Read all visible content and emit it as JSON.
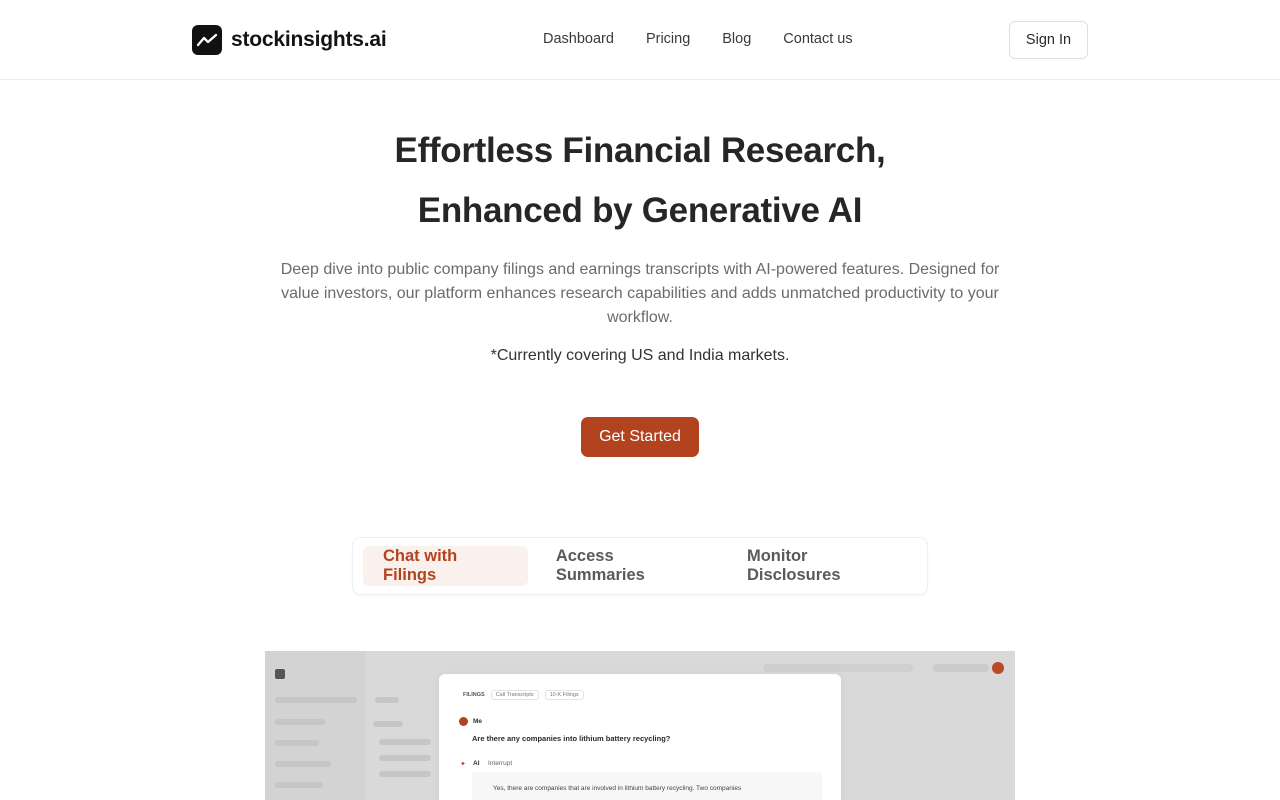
{
  "brand": {
    "name": "stockinsights.ai",
    "logo_icon": "trend-line-icon"
  },
  "nav": {
    "items": [
      {
        "label": "Dashboard"
      },
      {
        "label": "Pricing"
      },
      {
        "label": "Blog"
      },
      {
        "label": "Contact us"
      }
    ],
    "signin_label": "Sign In"
  },
  "hero": {
    "title_line1": "Effortless Financial Research,",
    "title_line2": "Enhanced by Generative AI",
    "description": "Deep dive into public company filings and earnings transcripts with AI-powered features. Designed for value investors, our platform enhances research capabilities and adds unmatched productivity to your workflow.",
    "note": "*Currently covering US and India markets.",
    "cta_label": "Get Started"
  },
  "tabs": [
    {
      "label": "Chat with Filings",
      "active": true
    },
    {
      "label": "Access Summaries",
      "active": false
    },
    {
      "label": "Monitor Disclosures",
      "active": false
    }
  ],
  "preview": {
    "filings_label": "FILINGS",
    "chip1": "Call Transcripts",
    "chip2": "10-K Filings",
    "me_label": "Me",
    "question": "Are there any companies into lithium battery recycling?",
    "ai_label": "AI",
    "interrupt_label": "Interrupt",
    "answer": "Yes, there are companies that are involved in lithium battery recycling. Two companies"
  },
  "colors": {
    "accent": "#b3431f",
    "tab_active_bg": "#faf1ed"
  }
}
